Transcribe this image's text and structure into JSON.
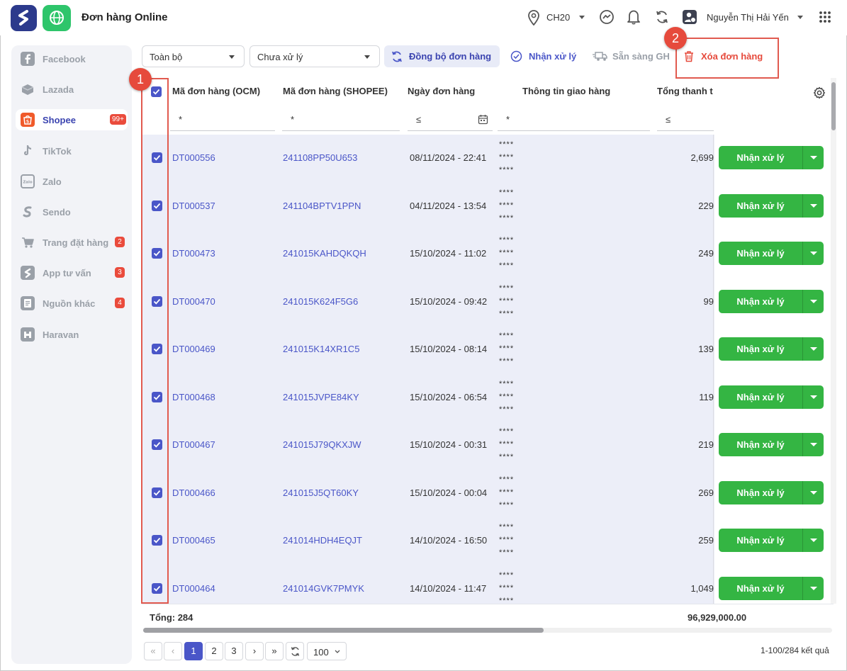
{
  "header": {
    "app_title": "Đơn hàng Online",
    "store": "CH20",
    "user_name": "Nguyễn Thị Hải Yến"
  },
  "sidebar": {
    "items": [
      {
        "label": "Facebook",
        "icon": "facebook-icon",
        "badge": ""
      },
      {
        "label": "Lazada",
        "icon": "lazada-icon",
        "badge": ""
      },
      {
        "label": "Shopee",
        "icon": "shopee-icon",
        "badge": "99+",
        "active": true
      },
      {
        "label": "TikTok",
        "icon": "tiktok-icon",
        "badge": ""
      },
      {
        "label": "Zalo",
        "icon": "zalo-icon",
        "badge": ""
      },
      {
        "label": "Sendo",
        "icon": "sendo-icon",
        "badge": ""
      },
      {
        "label": "Trang đặt hàng",
        "icon": "cart-icon",
        "badge": "2"
      },
      {
        "label": "App tư vấn",
        "icon": "app-icon",
        "badge": "3"
      },
      {
        "label": "Nguồn khác",
        "icon": "document-icon",
        "badge": "4"
      },
      {
        "label": "Haravan",
        "icon": "haravan-icon",
        "badge": ""
      }
    ]
  },
  "toolbar": {
    "scope_select": "Toàn bộ",
    "status_select": "Chưa xử lý",
    "sync_label": "Đồng bộ đơn hàng",
    "receive_label": "Nhận xử lý",
    "ready_label": "Sẵn sàng GH",
    "delete_label": "Xóa đơn hàng"
  },
  "callouts": [
    "1",
    "2"
  ],
  "table": {
    "columns": [
      "Mã đơn hàng (OCM)",
      "Mã đơn hàng (SHOPEE)",
      "Ngày đơn hàng",
      "Thông tin giao hàng",
      "Tổng thanh t"
    ],
    "filters": [
      "*",
      "*",
      "≤",
      "*",
      "≤"
    ],
    "rows": [
      {
        "ocm": "DT000556",
        "shopee": "241108PP50U653",
        "date": "08/11/2024 - 22:41",
        "ship": "****\n****\n****",
        "total": "2,699",
        "action": "Nhận xử lý"
      },
      {
        "ocm": "DT000537",
        "shopee": "241104BPTV1PPN",
        "date": "04/11/2024 - 13:54",
        "ship": "****\n****\n****",
        "total": "229",
        "action": "Nhận xử lý"
      },
      {
        "ocm": "DT000473",
        "shopee": "241015KAHDQKQH",
        "date": "15/10/2024 - 11:02",
        "ship": "****\n****\n****",
        "total": "249",
        "action": "Nhận xử lý"
      },
      {
        "ocm": "DT000470",
        "shopee": "241015K624F5G6",
        "date": "15/10/2024 - 09:42",
        "ship": "****\n****\n****",
        "total": "99",
        "action": "Nhận xử lý"
      },
      {
        "ocm": "DT000469",
        "shopee": "241015K14XR1C5",
        "date": "15/10/2024 - 08:14",
        "ship": "****\n****\n****",
        "total": "139",
        "action": "Nhận xử lý"
      },
      {
        "ocm": "DT000468",
        "shopee": "241015JVPE84KY",
        "date": "15/10/2024 - 06:54",
        "ship": "****\n****\n****",
        "total": "119",
        "action": "Nhận xử lý"
      },
      {
        "ocm": "DT000467",
        "shopee": "241015J79QKXJW",
        "date": "15/10/2024 - 00:31",
        "ship": "****\n****\n****",
        "total": "219",
        "action": "Nhận xử lý"
      },
      {
        "ocm": "DT000466",
        "shopee": "241015J5QT60KY",
        "date": "15/10/2024 - 00:04",
        "ship": "****\n****\n****",
        "total": "269",
        "action": "Nhận xử lý"
      },
      {
        "ocm": "DT000465",
        "shopee": "241014HDH4EQJT",
        "date": "14/10/2024 - 16:50",
        "ship": "****\n****\n****",
        "total": "259",
        "action": "Nhận xử lý"
      },
      {
        "ocm": "DT000464",
        "shopee": "241014GVK7PMYK",
        "date": "14/10/2024 - 11:47",
        "ship": "****\n****\n****",
        "total": "1,049",
        "action": "Nhận xử lý"
      }
    ],
    "footer_label": "Tổng: 284",
    "footer_sum": "96,929,000.00"
  },
  "pagination": {
    "pages": [
      "1",
      "2",
      "3"
    ],
    "current": "1",
    "page_size": "100",
    "result_text": "1-100/284 kết quả"
  },
  "colors": {
    "primary": "#4a56c8",
    "action_green": "#34b543",
    "danger": "#e64a3c",
    "shopee": "#f05a2a"
  }
}
